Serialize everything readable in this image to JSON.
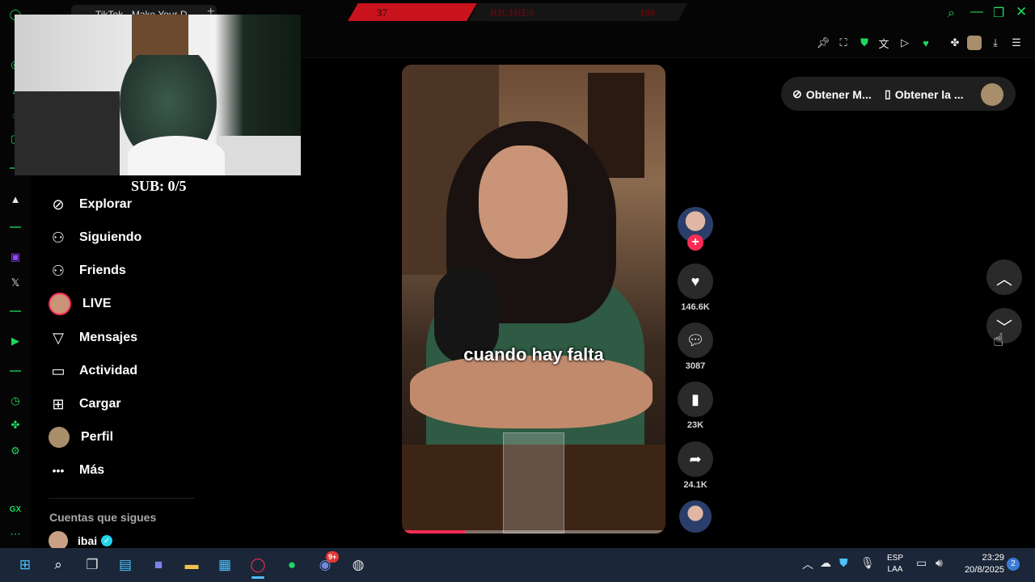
{
  "browser": {
    "tab_title": "TikTok - Make Your D...",
    "new_tab_label": "+"
  },
  "overlay": {
    "bar_left": "37",
    "bar_title": "RICHIES",
    "bar_right": "100",
    "sub_counter": "SUB: 0/5"
  },
  "sidebar": {
    "items": [
      {
        "label": "Explorar",
        "icon": "compass-icon",
        "glyph": "⊘"
      },
      {
        "label": "Siguiendo",
        "icon": "following-icon",
        "glyph": "⚇"
      },
      {
        "label": "Friends",
        "icon": "friends-icon",
        "glyph": "⚇"
      },
      {
        "label": "LIVE",
        "icon": "live-avatar-icon",
        "glyph": "●"
      },
      {
        "label": "Mensajes",
        "icon": "send-icon",
        "glyph": "▽"
      },
      {
        "label": "Actividad",
        "icon": "inbox-icon",
        "glyph": "▭"
      },
      {
        "label": "Cargar",
        "icon": "upload-icon",
        "glyph": "⊞"
      },
      {
        "label": "Perfil",
        "icon": "profile-avatar-icon",
        "glyph": "●"
      },
      {
        "label": "Más",
        "icon": "more-icon",
        "glyph": "•••"
      }
    ],
    "following_title": "Cuentas que sigues",
    "following": [
      {
        "name": "ibai",
        "verified": "✓"
      }
    ]
  },
  "video": {
    "caption": "cuando hay falta",
    "progress": 0.24
  },
  "actions": {
    "likes": "146.6K",
    "comments": "3087",
    "saves": "23K",
    "shares": "24.1K"
  },
  "get_bar": {
    "coins_label": "Obtener M...",
    "app_label": "Obtener la ..."
  },
  "taskbar": {
    "lang_top": "ESP",
    "lang_bottom": "LAA",
    "time": "23:29",
    "date": "20/8/2025",
    "notifications": "2",
    "discord_badge": "9+"
  },
  "colors": {
    "tiktok_red": "#fe2c55",
    "gx_green": "#1ed760",
    "taskbar": "#1b2638"
  }
}
